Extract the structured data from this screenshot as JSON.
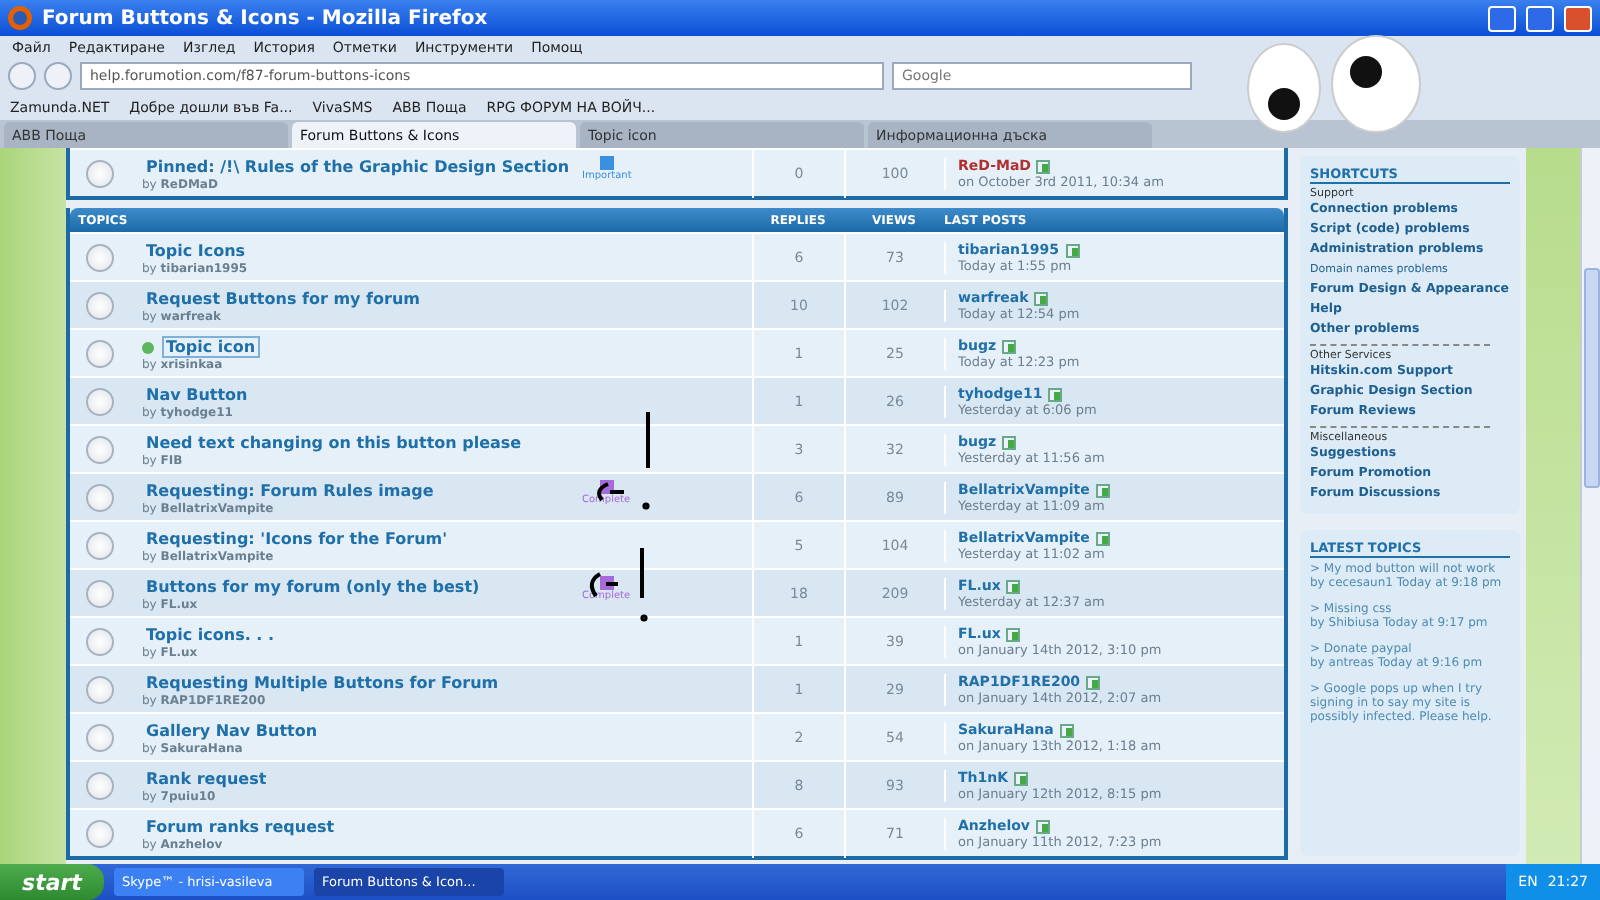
{
  "window": {
    "title": "Forum Buttons & Icons - Mozilla Firefox"
  },
  "menu": [
    "Файл",
    "Редактиране",
    "Изглед",
    "История",
    "Отметки",
    "Инструменти",
    "Помощ"
  ],
  "address": {
    "value": "help.forumotion.com/f87-forum-buttons-icons"
  },
  "search": {
    "placeholder": "Google"
  },
  "bookmarks": [
    {
      "label": "Zamunda.NET"
    },
    {
      "label": "Добре дошли във Fa..."
    },
    {
      "label": "VivaSMS"
    },
    {
      "label": "ABB Поща"
    },
    {
      "label": "RPG ФОРУМ НА ВОЙЧ..."
    }
  ],
  "tabs": [
    {
      "label": "ABB Поща",
      "selected": false
    },
    {
      "label": "Forum Buttons & Icons",
      "selected": true
    },
    {
      "label": "Topic icon",
      "selected": false
    },
    {
      "label": "Информационна дъска",
      "selected": false
    }
  ],
  "pinned": {
    "title": "Pinned: /!\\ Rules of the Graphic Design Section",
    "author": "by **ReDMaD**",
    "tag": {
      "label": "Important",
      "color": "#3a8fe0"
    },
    "replies": "0",
    "views": "100",
    "last_user": "ReD-MaD",
    "last_time": "on October 3rd 2011, 10:34 am"
  },
  "topics": {
    "heading": "TOPICS",
    "columns": [
      "REPLIES",
      "VIEWS",
      "LAST POSTS"
    ],
    "rows": [
      {
        "title": "Topic Icons",
        "author": "by **tibarian1995**",
        "replies": "6",
        "views": "73",
        "last_user": "tibarian1995",
        "last_time": "Today at 1:55 pm",
        "post_icon": false,
        "focused": false
      },
      {
        "title": "Request Buttons for my forum",
        "author": "by **warfreak**",
        "replies": "10",
        "views": "102",
        "last_user": "warfreak",
        "last_time": "Today at 12:54 pm",
        "post_icon": false,
        "focused": false
      },
      {
        "title": "Topic icon",
        "author": "by **xrisinkaa**",
        "replies": "1",
        "views": "25",
        "last_user": "bugz",
        "last_time": "Today at 12:23 pm",
        "post_icon": true,
        "focused": true
      },
      {
        "title": "Nav Button",
        "author": "by **tyhodge11**",
        "replies": "1",
        "views": "26",
        "last_user": "tyhodge11",
        "last_time": "Yesterday at 6:06 pm",
        "post_icon": false,
        "focused": false
      },
      {
        "title": "Need text changing on this button please",
        "author": "by **FIB**",
        "replies": "3",
        "views": "32",
        "last_user": "bugz",
        "last_time": "Yesterday at 11:56 am",
        "post_icon": false,
        "focused": false
      },
      {
        "title": "Requesting: Forum Rules image",
        "author": "by **BellatrixVampite**",
        "replies": "6",
        "views": "89",
        "last_user": "BellatrixVampite",
        "last_time": "Yesterday at 11:09 am",
        "post_icon": false,
        "focused": false,
        "tag": {
          "label": "Complete",
          "color": "#a56bd8"
        }
      },
      {
        "title": "Requesting: 'Icons for the Forum'",
        "author": "by **BellatrixVampite**",
        "replies": "5",
        "views": "104",
        "last_user": "BellatrixVampite",
        "last_time": "Yesterday at 11:02 am",
        "post_icon": false,
        "focused": false
      },
      {
        "title": "Buttons for my forum (only the best)",
        "author": "by **FL.ux**",
        "replies": "18",
        "views": "209",
        "last_user": "FL.ux",
        "last_time": "Yesterday at 12:37 am",
        "post_icon": false,
        "focused": false,
        "tag": {
          "label": "Complete",
          "color": "#a56bd8"
        }
      },
      {
        "title": "Topic icons. . .",
        "author": "by **FL.ux**",
        "replies": "1",
        "views": "39",
        "last_user": "FL.ux",
        "last_time": "on January 14th 2012, 3:10 pm",
        "post_icon": false,
        "focused": false
      },
      {
        "title": "Requesting Multiple Buttons for Forum",
        "author": "by **RAP1DF1RE200**",
        "replies": "1",
        "views": "29",
        "last_user": "RAP1DF1RE200",
        "last_time": "on January 14th 2012, 2:07 am",
        "post_icon": false,
        "focused": false
      },
      {
        "title": "Gallery Nav Button",
        "author": "by **SakuraHana**",
        "replies": "2",
        "views": "54",
        "last_user": "SakuraHana",
        "last_time": "on January 13th 2012, 1:18 am",
        "post_icon": false,
        "focused": false
      },
      {
        "title": "Rank request",
        "author": "by **7puiu10**",
        "replies": "8",
        "views": "93",
        "last_user": "Th1nK",
        "last_time": "on January 12th 2012, 8:15 pm",
        "post_icon": false,
        "focused": false
      },
      {
        "title": "Forum ranks request",
        "author": "by **Anzhelov**",
        "replies": "6",
        "views": "71",
        "last_user": "Anzhelov",
        "last_time": "on January 11th 2012, 7:23 pm",
        "post_icon": false,
        "focused": false
      }
    ]
  },
  "sidebar": {
    "shortcuts": {
      "title": "SHORTCUTS",
      "groups": [
        {
          "heading": "Support",
          "links": [
            {
              "label": "Connection problems",
              "kind": "link"
            },
            {
              "label": "Script (code) problems",
              "kind": "link"
            },
            {
              "label": "Administration problems",
              "kind": "link"
            },
            {
              "label": "Domain names problems",
              "kind": "minor"
            },
            {
              "label": "Forum Design & Appearance",
              "kind": "link"
            },
            {
              "label": "Help",
              "kind": "link"
            },
            {
              "label": "Other problems",
              "kind": "link"
            }
          ]
        },
        {
          "heading": "Other Services",
          "links": [
            {
              "label": "Hitskin.com Support",
              "kind": "link"
            },
            {
              "label": "Graphic Design Section",
              "kind": "link"
            },
            {
              "label": "Forum Reviews",
              "kind": "link"
            }
          ]
        },
        {
          "heading": "Miscellaneous",
          "links": [
            {
              "label": "Suggestions",
              "kind": "link"
            },
            {
              "label": "Forum Promotion",
              "kind": "link"
            },
            {
              "label": "Forum Discussions",
              "kind": "link"
            }
          ]
        }
      ]
    },
    "latest": {
      "title": "LATEST TOPICS",
      "items": [
        {
          "title": "> My mod button will not work",
          "byline": "by cecesaun1 Today at 9:18 pm"
        },
        {
          "title": "> Missing css",
          "byline": "by Shibiusa Today at 9:17 pm"
        },
        {
          "title": "> Donate paypal",
          "byline": "by antreas Today at 9:16 pm"
        },
        {
          "title": "> Google pops up when I try signing in to say my site is possibly infected. Please help."
        }
      ]
    }
  },
  "taskbar": {
    "start": "start",
    "tasks": [
      {
        "label": "Skype™ - hrisi-vasileva",
        "selected": false
      },
      {
        "label": "Forum Buttons & Icon...",
        "selected": true
      }
    ],
    "lang": "EN",
    "clock": "21:27"
  }
}
